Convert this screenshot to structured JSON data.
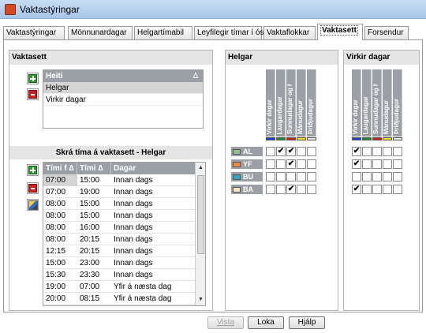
{
  "window": {
    "title": "Vaktastýringar"
  },
  "tabs": [
    "Vaktastýringar",
    "Mönnunardagar",
    "Helgartímabil",
    "Leyfilegir tímar í óskum",
    "Vaktaflokkar",
    "Vaktasett",
    "Forsendur"
  ],
  "active_tab": "Vaktasett",
  "left": {
    "title": "Vaktasett",
    "list": {
      "header": "Heiti",
      "items": [
        "Helgar",
        "Virkir dagar"
      ],
      "selected": "Helgar"
    },
    "schedule_title": "Skrá tíma á vaktasett - Helgar",
    "grid": {
      "headers": [
        "Tími f",
        "Tími",
        "Dagar"
      ],
      "rows": [
        [
          "07:00",
          "15:00",
          "Innan dags"
        ],
        [
          "07:00",
          "19:00",
          "Innan dags"
        ],
        [
          "08:00",
          "15:00",
          "Innan dags"
        ],
        [
          "08:00",
          "15:00",
          "Innan dags"
        ],
        [
          "08:00",
          "16:00",
          "Innan dags"
        ],
        [
          "08:00",
          "20:15",
          "Innan dags"
        ],
        [
          "12:15",
          "20:15",
          "Innan dags"
        ],
        [
          "15:00",
          "23:00",
          "Innan dags"
        ],
        [
          "15:30",
          "23:30",
          "Innan dags"
        ],
        [
          "19:00",
          "07:00",
          "Yfir á næsta dag"
        ],
        [
          "20:00",
          "08:15",
          "Yfir á næsta dag"
        ]
      ]
    }
  },
  "day_columns": [
    {
      "label": "Virkir dagar",
      "color": "#1a3fd6"
    },
    {
      "label": "Laugardagar",
      "color": "#1a8a2a"
    },
    {
      "label": "Sunnudagar og h...",
      "color": "#d81a1a"
    },
    {
      "label": "Mánudagur",
      "color": "#f2e21a"
    },
    {
      "label": "Þriðjudagur",
      "color": "#e8e8e8"
    }
  ],
  "shift_rows": [
    {
      "label": "AL",
      "color": "#8fbf8f"
    },
    {
      "label": "YF",
      "color": "#f08a3c"
    },
    {
      "label": "BU",
      "color": "#33a6c8"
    },
    {
      "label": "BA",
      "color": "#f4e4c4"
    }
  ],
  "helgar": {
    "title": "Helgar",
    "checks": [
      [
        false,
        true,
        true,
        false,
        false
      ],
      [
        false,
        false,
        true,
        false,
        false
      ],
      [
        false,
        false,
        false,
        false,
        false
      ],
      [
        false,
        false,
        true,
        false,
        false
      ]
    ]
  },
  "virkir": {
    "title": "Virkir dagar",
    "checks": [
      [
        true,
        false,
        false,
        false,
        false
      ],
      [
        true,
        false,
        false,
        false,
        false
      ],
      [
        false,
        false,
        false,
        false,
        false
      ],
      [
        true,
        false,
        false,
        false,
        false
      ]
    ]
  },
  "buttons": {
    "save": "Vista",
    "close": "Loka",
    "help": "Hjálp"
  }
}
